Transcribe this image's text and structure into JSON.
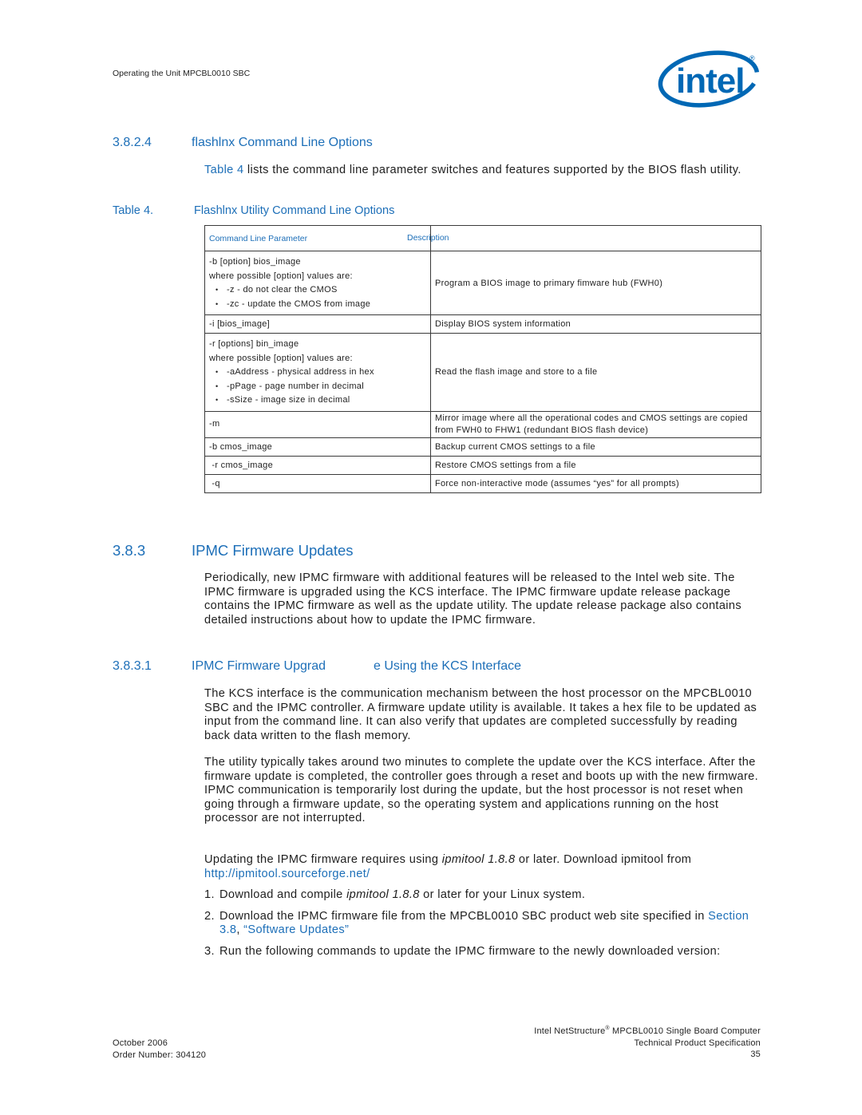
{
  "header": {
    "running_title": "Operating the Unit MPCBL0010 SBC",
    "logo": {
      "text": "intel",
      "mark": "®",
      "brand_color": "#0068b5"
    }
  },
  "section_3824": {
    "number": "3.8.2.4",
    "title": "flashlnx Command Line Options",
    "intro_link": "Table 4",
    "intro_text": " lists the command line parameter switches and features supported by the BIOS flash utility."
  },
  "table4": {
    "caption_number": "Table 4.",
    "caption_title": "Flashlnx Utility Command Line Options",
    "headers": [
      "Command Line Parameter",
      "Description"
    ],
    "rows": [
      {
        "param_lines": [
          "-b [option] bios_image",
          "where possible [option] values are:"
        ],
        "param_bullets": [
          "-z - do not clear the CMOS",
          "-zc - update the CMOS from image"
        ],
        "description": "Program a BIOS image to primary fimware hub (FWH0)"
      },
      {
        "param_lines": [
          "-i [bios_image]"
        ],
        "param_bullets": [],
        "description": "Display BIOS system information"
      },
      {
        "param_lines": [
          "-r [options] bin_image",
          "where possible [option] values are:"
        ],
        "param_bullets": [
          "-aAddress - physical address in hex",
          "-pPage - page number in decimal",
          "-sSize - image size in decimal"
        ],
        "description": "Read the flash image and store to a file"
      },
      {
        "param_lines": [
          "-m"
        ],
        "param_bullets": [],
        "description": "Mirror image where all the operational codes and CMOS settings are copied from FWH0 to FHW1 (redundant BIOS flash device)"
      },
      {
        "param_lines": [
          "-b cmos_image"
        ],
        "param_bullets": [],
        "description": "Backup current CMOS settings to a file"
      },
      {
        "param_lines": [
          " -r cmos_image"
        ],
        "param_bullets": [],
        "description": "Restore CMOS settings from a file"
      },
      {
        "param_lines": [
          " -q"
        ],
        "param_bullets": [],
        "description": "Force non-interactive mode (assumes “yes” for all prompts)"
      }
    ]
  },
  "section_383": {
    "number": "3.8.3",
    "title": "IPMC Firmware Updates",
    "paragraph": "Periodically, new IPMC firmware with additional features will be released to the Intel web site. The IPMC firmware is upgraded using the KCS interface. The IPMC firmware update release package contains the IPMC firmware as well as the update utility. The update release package also contains detailed instructions about how to update the IPMC firmware."
  },
  "section_3831": {
    "number": "3.8.3.1",
    "title_part1": "IPMC Firmware Upgrad",
    "title_part2": "e Using the KCS Interface",
    "paragraph1": "The KCS interface is the communication mechanism between the host processor on the MPCBL0010 SBC and the IPMC controller. A firmware update utility is available. It takes a hex file to be updated as input from the command line. It can also verify that updates are completed successfully by reading back data written to the flash memory.",
    "paragraph2": "The utility typically takes around two minutes to complete the update over the KCS interface. After the firmware update is completed, the controller goes through a reset and boots up with the new firmware. IPMC communication is temporarily lost during the update, but the host processor is not reset when going through a firmware update, so the operating system and applications running on the host processor are not interrupted.",
    "paragraph3": {
      "before": "Updating the IPMC firmware requires using ",
      "italic": "ipmitool 1.8.8",
      "middle": " or later. Download ipmitool from ",
      "link": "http://ipmitool.sourceforge.net/"
    },
    "steps": [
      {
        "number": "1.",
        "before": "Download and compile ",
        "italic": "ipmitool 1.8.8",
        "after": " or later for your Linux system."
      },
      {
        "number": "2.",
        "before": "Download the IPMC firmware file from the MPCBL0010 SBC product web site specified in ",
        "link1": "Section 3.8",
        "sep": ", ",
        "link2": "“Software Updates”"
      },
      {
        "number": "3.",
        "text": "Run the following commands to update the IPMC firmware to the newly downloaded version:"
      }
    ]
  },
  "footer": {
    "date": "October 2006",
    "order_number": "Order Number: 304120",
    "product_prefix": "Intel NetStructure",
    "product_mark": "®",
    "product_suffix": " MPCBL0010 Single Board Computer",
    "doc_type": "Technical Product Specification",
    "page_number": "35"
  }
}
